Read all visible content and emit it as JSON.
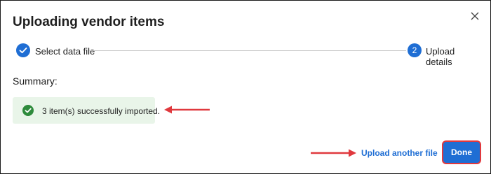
{
  "dialog": {
    "title": "Uploading vendor items",
    "close_icon": "close-icon"
  },
  "stepper": {
    "steps": [
      {
        "label": "Select data file",
        "state": "completed",
        "icon": "check-icon"
      },
      {
        "label": "Upload details",
        "state": "active",
        "number": "2"
      }
    ]
  },
  "summary": {
    "label": "Summary:",
    "alert_text": "3 item(s) successfully imported.",
    "alert_icon": "success-check-icon"
  },
  "footer": {
    "upload_another_label": "Upload another file",
    "done_label": "Done"
  },
  "colors": {
    "accent": "#1f6ed4",
    "success": "#2e8b3c",
    "success_bg": "#e9f5e9",
    "annotation_red": "#e0393e"
  }
}
